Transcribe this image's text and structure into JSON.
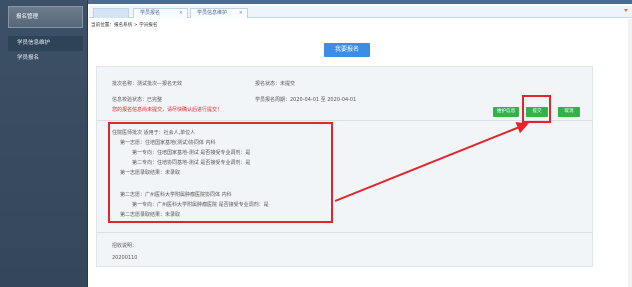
{
  "sidebar": {
    "header": "报名管理",
    "items": [
      {
        "label": "学员信息维护",
        "active": true
      },
      {
        "label": "学员报名",
        "active": false
      }
    ]
  },
  "tabs": [
    {
      "label": ""
    },
    {
      "label": "学员报名",
      "close": "×"
    },
    {
      "label": "学员信息维护",
      "close": "×"
    }
  ],
  "breadcrumb": "当前位置：报名系统 > 学员报名",
  "main_button": "我要报名",
  "info": {
    "batch_name": "批次名称：测试批次—报名无效",
    "signup_status": "报名状态：未提交",
    "approval_status": "信息校验状态：已完整",
    "signup_period": "学员报名周期：2020-04-01 至 2020-04-01",
    "warning": "您的报名信息尚未提交，请尽快确认后进行提交！"
  },
  "actions": {
    "maintain": "维护信息",
    "submit": "提交",
    "cancel": "取消"
  },
  "choices": {
    "line1": "住院医师批次 适用于：社会人,单位人",
    "line2": "第一志愿：住培国家基地(测试)协同体         内科",
    "line3": "第一专向：住培国家基地-测试          是否接受专业调剂：是",
    "line4": "第二专向：住培协同基地-测试          是否接受专业调剂：是",
    "line5": "第一志愿录取结果：未录取",
    "line6": "第二志愿：广州医科大学附属肿瘤医院协同体         内科",
    "line7": "第一专向：广州医科大学附属肿瘤医院             是否接受专业调剂：是",
    "line8": "第二志愿录取结果：未录取"
  },
  "notes": {
    "label": "招收说明：",
    "value": "20200110"
  },
  "colors": {
    "sidebar_bg": "#3c5067",
    "primary": "#3a8ee6",
    "green": "#33b24a",
    "highlight_red": "#e2252b"
  }
}
